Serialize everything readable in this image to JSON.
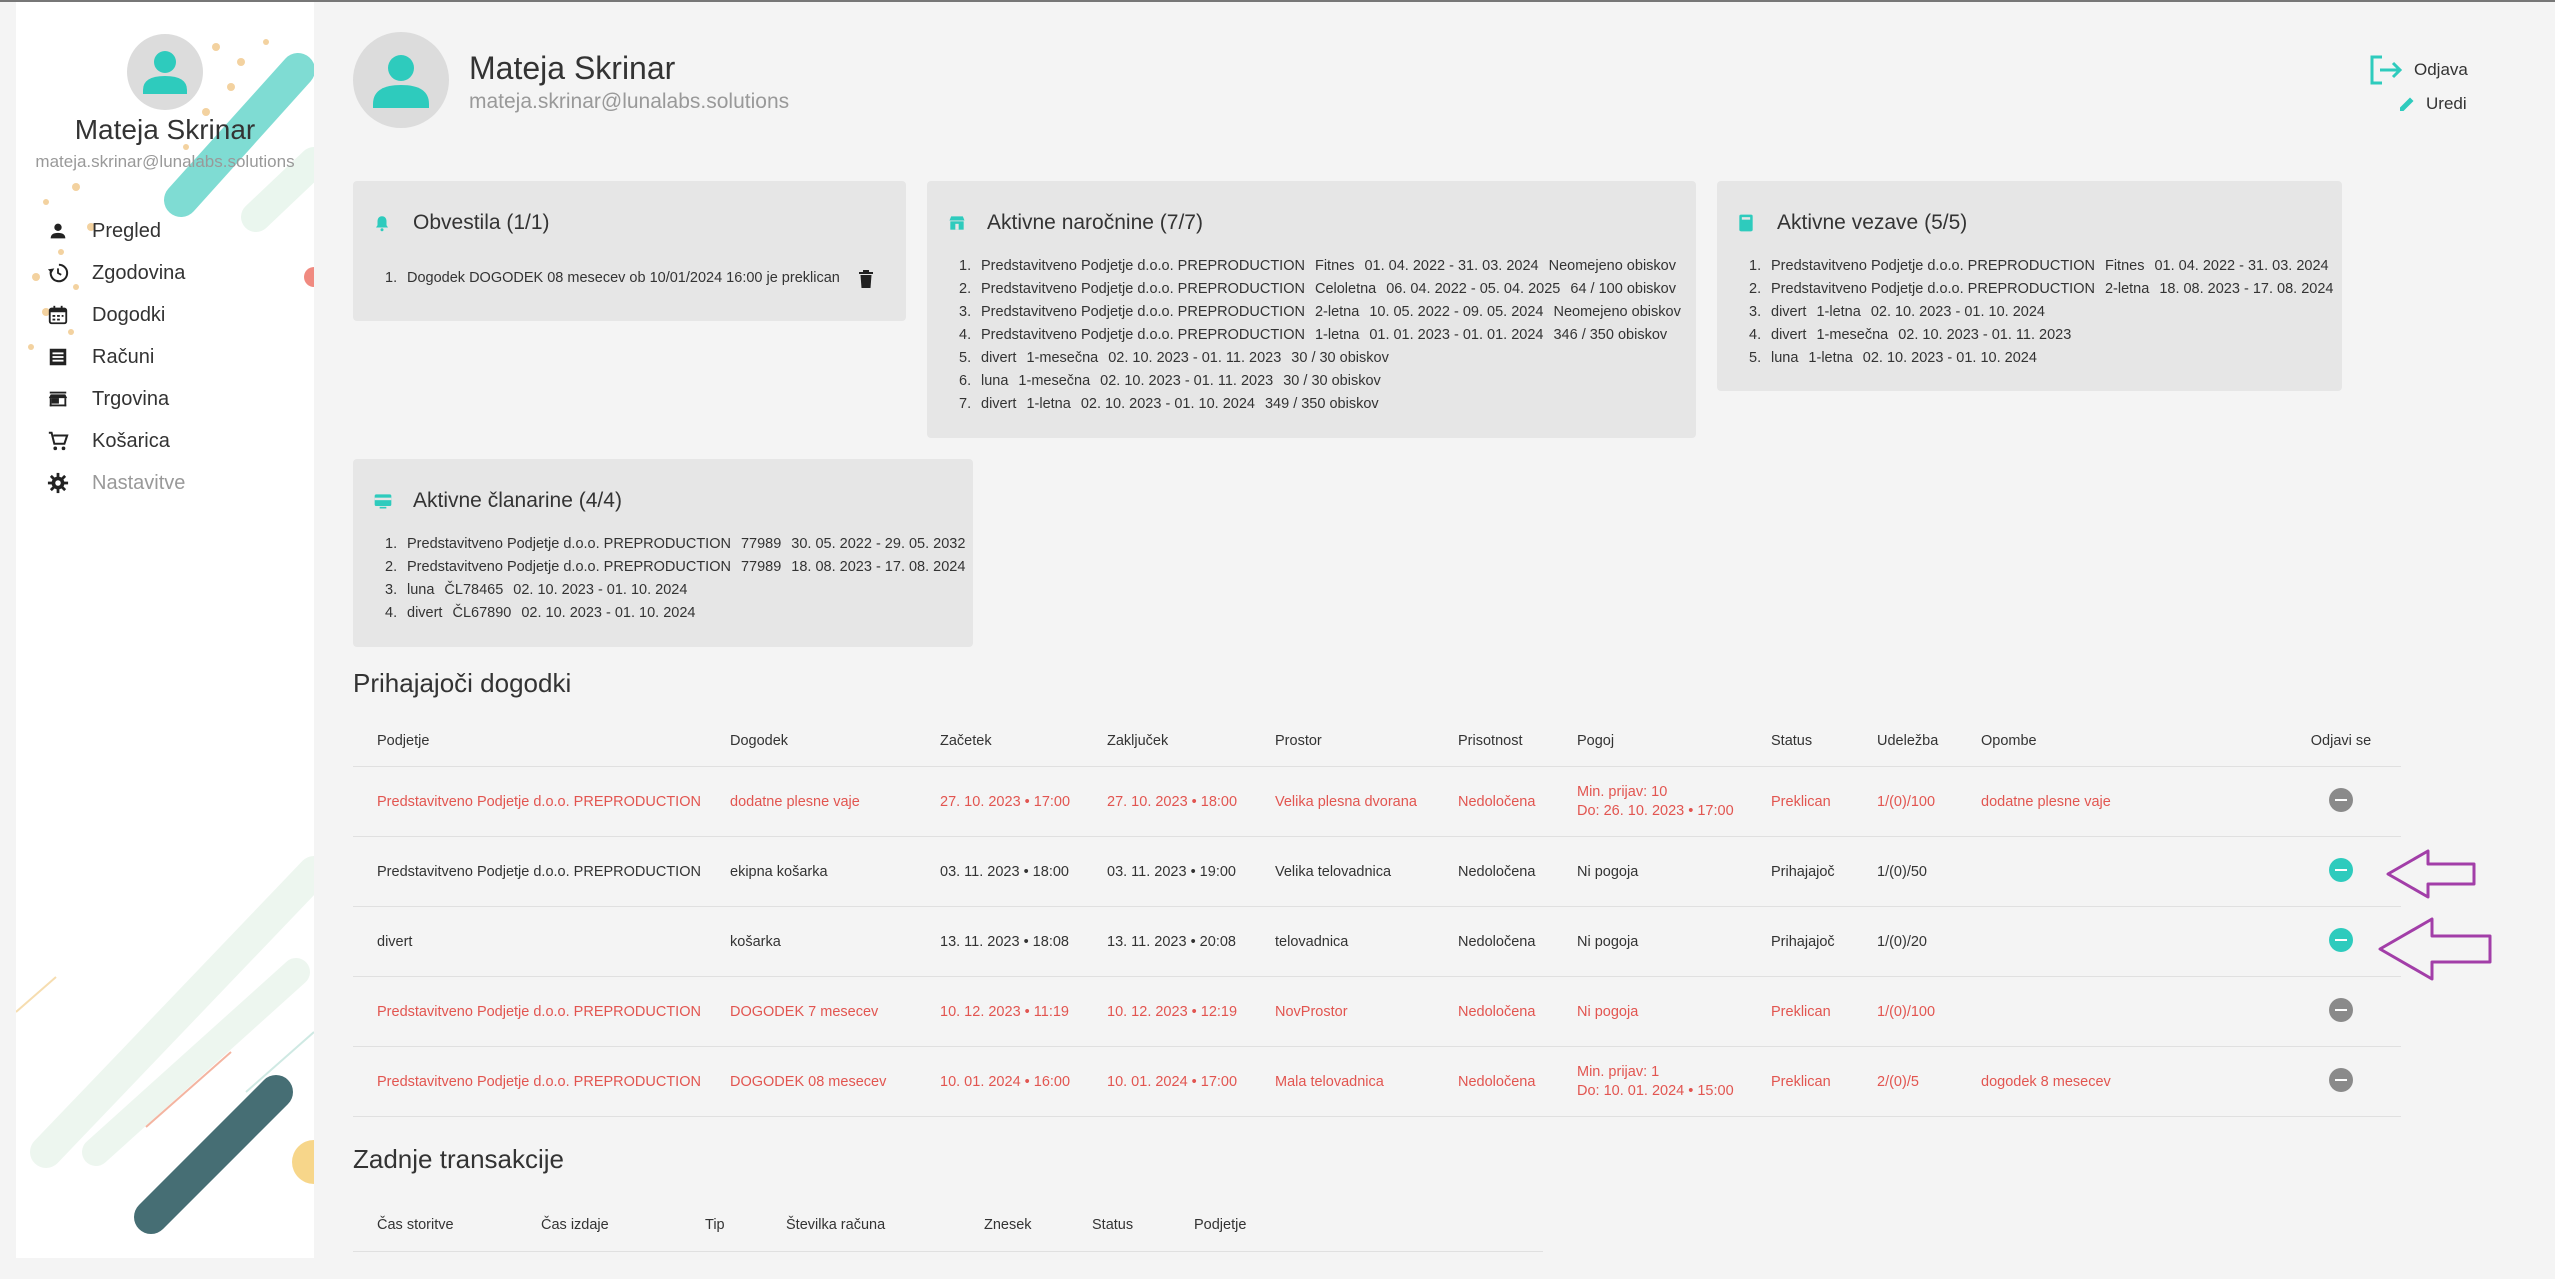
{
  "user": {
    "name": "Mateja Skrinar",
    "email": "mateja.skrinar@lunalabs.solutions"
  },
  "sidebar": {
    "items": [
      {
        "label": "Pregled",
        "icon": "person-icon"
      },
      {
        "label": "Zgodovina",
        "icon": "history-icon"
      },
      {
        "label": "Dogodki",
        "icon": "calendar-icon"
      },
      {
        "label": "Računi",
        "icon": "receipt-icon"
      },
      {
        "label": "Trgovina",
        "icon": "store-icon"
      },
      {
        "label": "Košarica",
        "icon": "cart-icon"
      },
      {
        "label": "Nastavitve",
        "icon": "gear-icon"
      }
    ]
  },
  "header": {
    "logout_label": "Odjava",
    "edit_label": "Uredi"
  },
  "cards": {
    "notifications": {
      "title": "Obvestila (1/1)",
      "items": [
        "Dogodek DOGODEK 08 mesecev ob 10/01/2024 16:00 je preklican"
      ]
    },
    "subscriptions": {
      "title": "Aktivne naročnine (7/7)",
      "items": [
        [
          "Predstavitveno Podjetje d.o.o. PREPRODUCTION",
          "Fitnes",
          "01. 04. 2022 - 31. 03. 2024",
          "Neomejeno obiskov"
        ],
        [
          "Predstavitveno Podjetje d.o.o. PREPRODUCTION",
          "Celoletna",
          "06. 04. 2022 - 05. 04. 2025",
          "64 / 100 obiskov"
        ],
        [
          "Predstavitveno Podjetje d.o.o. PREPRODUCTION",
          "2-letna",
          "10. 05. 2022 - 09. 05. 2024",
          "Neomejeno obiskov"
        ],
        [
          "Predstavitveno Podjetje d.o.o. PREPRODUCTION",
          "1-letna",
          "01. 01. 2023 - 01. 01. 2024",
          "346 / 350 obiskov"
        ],
        [
          "divert",
          "1-mesečna",
          "02. 10. 2023 - 01. 11. 2023",
          "30 / 30 obiskov"
        ],
        [
          "luna",
          "1-mesečna",
          "02. 10. 2023 - 01. 11. 2023",
          "30 / 30 obiskov"
        ],
        [
          "divert",
          "1-letna",
          "02. 10. 2023 - 01. 10. 2024",
          "349 / 350 obiskov"
        ]
      ]
    },
    "bonds": {
      "title": "Aktivne vezave (5/5)",
      "items": [
        [
          "Predstavitveno Podjetje d.o.o. PREPRODUCTION",
          "Fitnes",
          "01. 04. 2022 - 31. 03. 2024"
        ],
        [
          "Predstavitveno Podjetje d.o.o. PREPRODUCTION",
          "2-letna",
          "18. 08. 2023 - 17. 08. 2024"
        ],
        [
          "divert",
          "1-letna",
          "02. 10. 2023 - 01. 10. 2024"
        ],
        [
          "divert",
          "1-mesečna",
          "02. 10. 2023 - 01. 11. 2023"
        ],
        [
          "luna",
          "1-letna",
          "02. 10. 2023 - 01. 10. 2024"
        ]
      ]
    },
    "memberships": {
      "title": "Aktivne članarine (4/4)",
      "items": [
        [
          "Predstavitveno Podjetje d.o.o. PREPRODUCTION",
          "77989",
          "30. 05. 2022 - 29. 05. 2032"
        ],
        [
          "Predstavitveno Podjetje d.o.o. PREPRODUCTION",
          "77989",
          "18. 08. 2023 - 17. 08. 2024"
        ],
        [
          "luna",
          "ČL78465",
          "02. 10. 2023 - 01. 10. 2024"
        ],
        [
          "divert",
          "ČL67890",
          "02. 10. 2023 - 01. 10. 2024"
        ]
      ]
    }
  },
  "events": {
    "title": "Prihajajoči dogodki",
    "columns": [
      "Podjetje",
      "Dogodek",
      "Začetek",
      "Zaključek",
      "Prostor",
      "Prisotnost",
      "Pogoj",
      "Status",
      "Udeležba",
      "Opombe",
      "Odjavi se"
    ],
    "rows": [
      {
        "company": "Predstavitveno Podjetje d.o.o. PREPRODUCTION",
        "event": "dodatne plesne vaje",
        "start": "27. 10. 2023 • 17:00",
        "end": "27. 10. 2023 • 18:00",
        "room": "Velika plesna dvorana",
        "presence": "Nedoločena",
        "cond1": "Min. prijav: 10",
        "cond2": "Do: 26. 10. 2023 • 17:00",
        "status": "Preklican",
        "attendance": "1/(0)/100",
        "notes": "dodatne plesne vaje",
        "cancelled": true
      },
      {
        "company": "Predstavitveno Podjetje d.o.o. PREPRODUCTION",
        "event": "ekipna košarka",
        "start": "03. 11. 2023 • 18:00",
        "end": "03. 11. 2023 • 19:00",
        "room": "Velika telovadnica",
        "presence": "Nedoločena",
        "cond1": "Ni pogoja",
        "cond2": "",
        "status": "Prihajajoč",
        "attendance": "1/(0)/50",
        "notes": "",
        "cancelled": false
      },
      {
        "company": "divert",
        "event": "košarka",
        "start": "13. 11. 2023 • 18:08",
        "end": "13. 11. 2023 • 20:08",
        "room": "telovadnica",
        "presence": "Nedoločena",
        "cond1": "Ni pogoja",
        "cond2": "",
        "status": "Prihajajoč",
        "attendance": "1/(0)/20",
        "notes": "",
        "cancelled": false
      },
      {
        "company": "Predstavitveno Podjetje d.o.o. PREPRODUCTION",
        "event": "DOGODEK 7 mesecev",
        "start": "10. 12. 2023 • 11:19",
        "end": "10. 12. 2023 • 12:19",
        "room": "NovProstor",
        "presence": "Nedoločena",
        "cond1": "Ni pogoja",
        "cond2": "",
        "status": "Preklican",
        "attendance": "1/(0)/100",
        "notes": "",
        "cancelled": true
      },
      {
        "company": "Predstavitveno Podjetje d.o.o. PREPRODUCTION",
        "event": "DOGODEK 08 mesecev",
        "start": "10. 01. 2024 • 16:00",
        "end": "10. 01. 2024 • 17:00",
        "room": "Mala telovadnica",
        "presence": "Nedoločena",
        "cond1": "Min. prijav: 1",
        "cond2": "Do: 10. 01. 2024 • 15:00",
        "status": "Preklican",
        "attendance": "2/(0)/5",
        "notes": "dogodek 8 mesecev",
        "cancelled": true
      }
    ]
  },
  "transactions": {
    "title": "Zadnje transakcije",
    "columns": [
      "Čas storitve",
      "Čas izdaje",
      "Tip",
      "Številka računa",
      "Znesek",
      "Status",
      "Podjetje"
    ]
  },
  "colors": {
    "accent": "#2ecbbd",
    "cancel": "#e25550",
    "annotation": "#a23ea8"
  }
}
